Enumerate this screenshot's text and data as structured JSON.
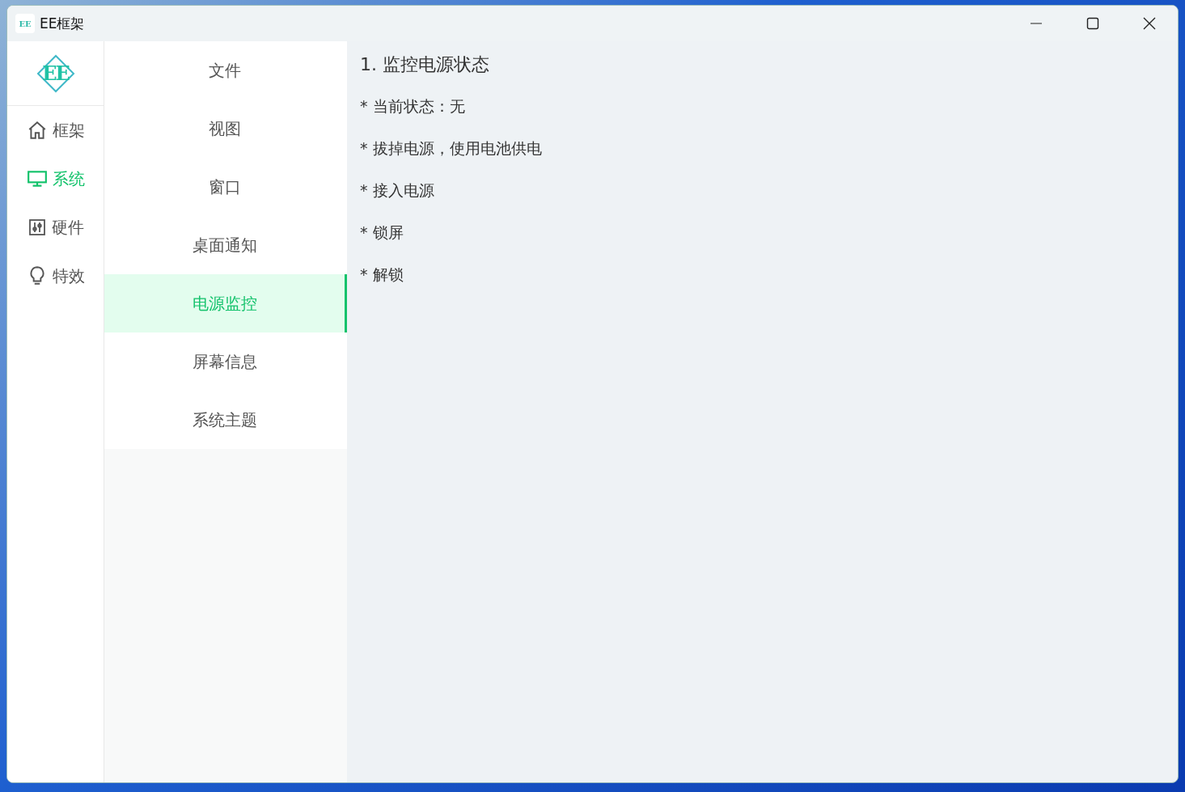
{
  "window": {
    "title": "EE框架",
    "icon_text": "EE"
  },
  "logo": {
    "text": "EE"
  },
  "sidebar": {
    "items": [
      {
        "label": "框架",
        "selected": false
      },
      {
        "label": "系统",
        "selected": true
      },
      {
        "label": "硬件",
        "selected": false
      },
      {
        "label": "特效",
        "selected": false
      }
    ]
  },
  "submenu": {
    "items": [
      {
        "label": "文件",
        "selected": false
      },
      {
        "label": "视图",
        "selected": false
      },
      {
        "label": "窗口",
        "selected": false
      },
      {
        "label": "桌面通知",
        "selected": false
      },
      {
        "label": "电源监控",
        "selected": true
      },
      {
        "label": "屏幕信息",
        "selected": false
      },
      {
        "label": "系统主题",
        "selected": false
      }
    ]
  },
  "content": {
    "heading": "1. 监控电源状态",
    "lines": [
      "* 当前状态：无",
      "* 拔掉电源，使用电池供电",
      "* 接入电源",
      "* 锁屏",
      "* 解锁"
    ]
  }
}
